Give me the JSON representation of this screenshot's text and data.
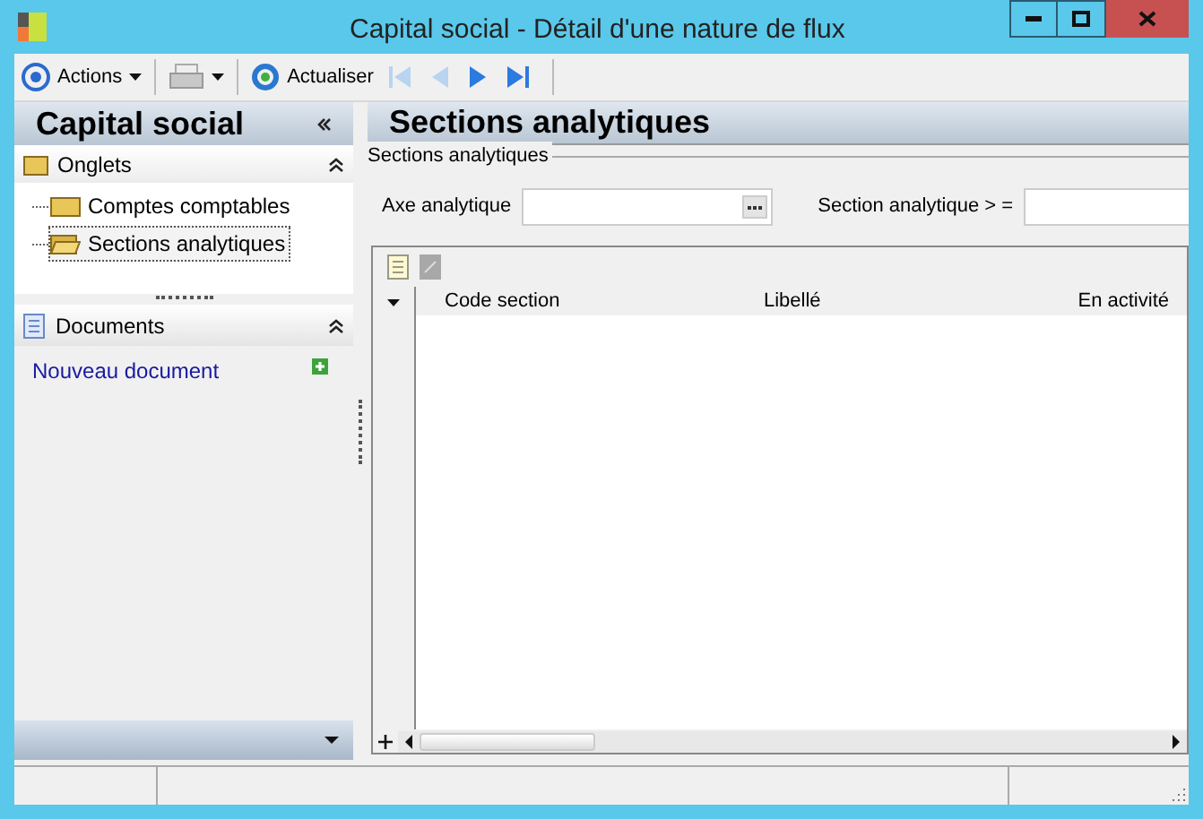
{
  "window": {
    "title": "Capital social -  Détail d'une nature de flux"
  },
  "toolbar": [
    {
      "kind": "target",
      "label": "Actions",
      "dropdown": true
    },
    {
      "kind": "print",
      "dropdown": true
    },
    {
      "kind": "refresh",
      "label": "Actualiser"
    },
    {
      "kind": "first",
      "disabled": true
    },
    {
      "kind": "prev",
      "disabled": true
    },
    {
      "kind": "next",
      "disabled": false
    },
    {
      "kind": "last",
      "disabled": false
    }
  ],
  "sidebar": {
    "title": "Capital social",
    "tabs_section": {
      "title": "Onglets",
      "expanded": true,
      "items": [
        {
          "label": "Comptes comptables",
          "selected": false
        },
        {
          "label": "Sections analytiques",
          "selected": true
        }
      ]
    },
    "documents_section": {
      "title": "Documents",
      "expanded": true,
      "link": "Nouveau document"
    }
  },
  "main": {
    "title": "Sections analytiques",
    "group": "Sections analytiques",
    "fields": [
      {
        "label": "Axe analytique",
        "kind": "lookup"
      },
      {
        "label": "Section analytique > =",
        "kind": "text"
      }
    ],
    "table": {
      "columns": [
        "Code section",
        "Libellé",
        "En activité"
      ]
    }
  }
}
